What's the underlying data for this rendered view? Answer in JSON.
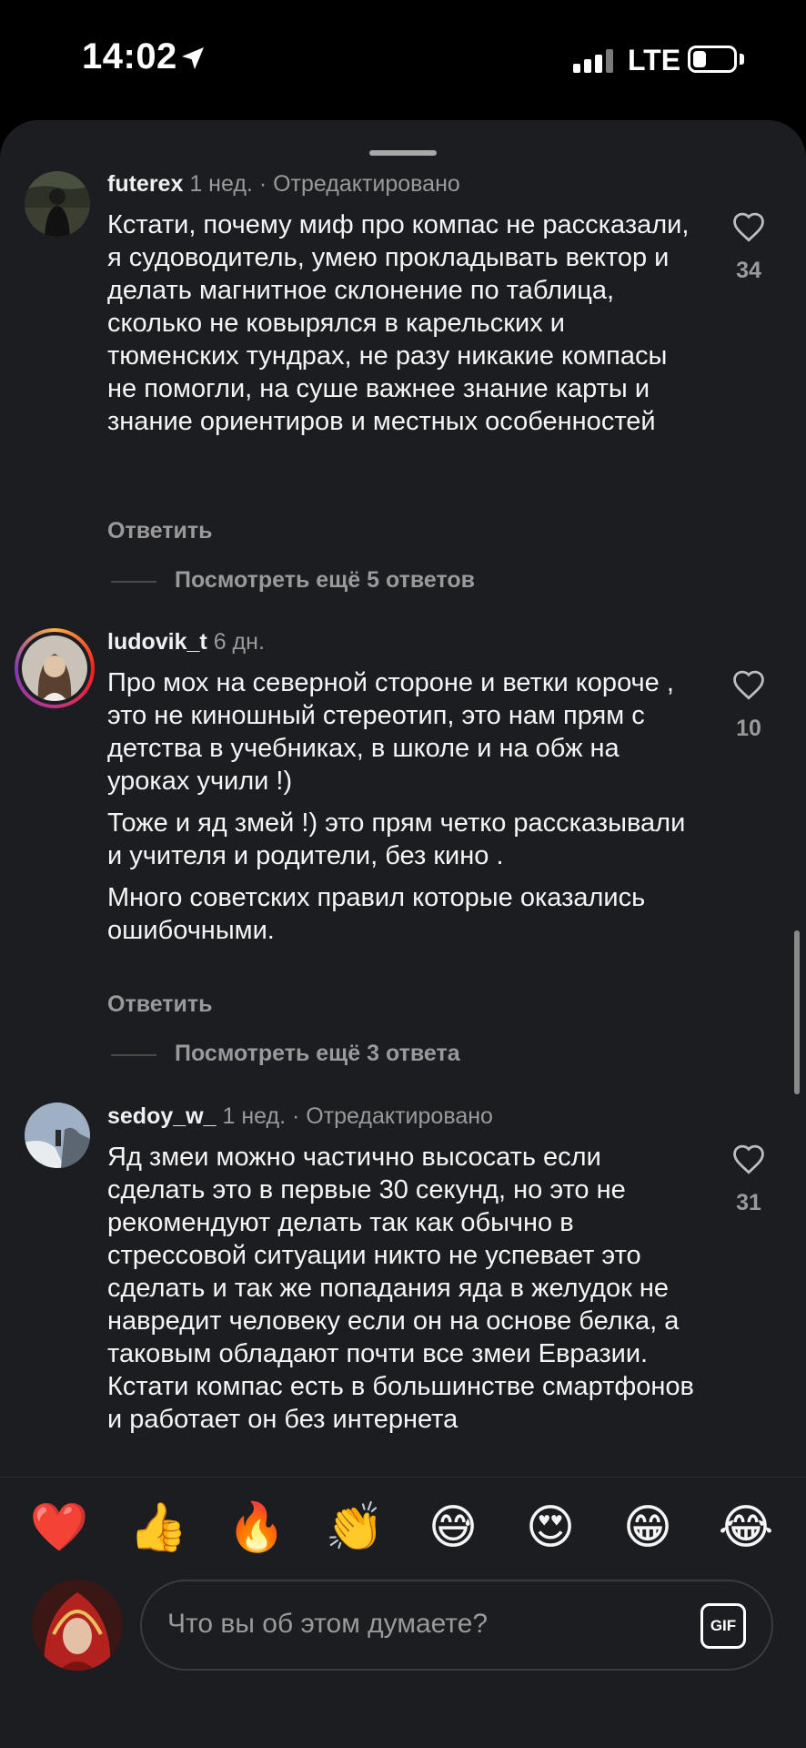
{
  "status": {
    "time": "14:02",
    "network": "LTE"
  },
  "comments": [
    {
      "username": "futerex",
      "time": "1 нед.",
      "edited": "· Отредактировано",
      "paragraphs": [
        "Кстати, почему миф про компас не рассказали, я судоводитель, умею прокладывать вектор и делать магнитное склонение по таблица, сколько не ковырялся в карельских и тюменских тундрах, не разу никакие компасы не помогли, на суше важнее знание карты и знание ориентиров и местных особенностей"
      ],
      "likes": "34",
      "reply_label": "Ответить",
      "more_replies": "Посмотреть ещё 5 ответов"
    },
    {
      "username": "ludovik_t",
      "time": "6 дн.",
      "edited": "",
      "paragraphs": [
        "Про мох на северной стороне и ветки короче , это не киношный стереотип, это нам прям с детства в учебниках, в школе и на обж на уроках учили !)",
        "Тоже и яд змей !) это прям четко рассказывали и учителя и родители, без кино .",
        "Много советских правил которые оказались ошибочными."
      ],
      "likes": "10",
      "reply_label": "Ответить",
      "more_replies": "Посмотреть ещё 3 ответа"
    },
    {
      "username": "sedoy_w_",
      "time": "1 нед.",
      "edited": "· Отредактировано",
      "paragraphs": [
        "Яд змеи можно частично высосать если сделать это в первые 30 секунд, но это не рекомендуют делать так как обычно в стрессовой ситуации никто не успевает это сделать и так же попадания яда в желудок не навредит человеку если он на основе белка, а таковым обладают почти все змеи Евразии. Кстати компас есть в большинстве смартфонов и работает он без интернета"
      ],
      "likes": "31"
    }
  ],
  "reactions": [
    "❤️",
    "👍",
    "🔥",
    "👏",
    "😅",
    "😍",
    "😁",
    "😂"
  ],
  "composer": {
    "placeholder": "Что вы об этом думаете?",
    "gif_label": "GIF"
  },
  "colors": {
    "sheet_bg": "#1c1d20",
    "text_primary": "#f5f5f5",
    "text_secondary": "#9a9a9a"
  }
}
